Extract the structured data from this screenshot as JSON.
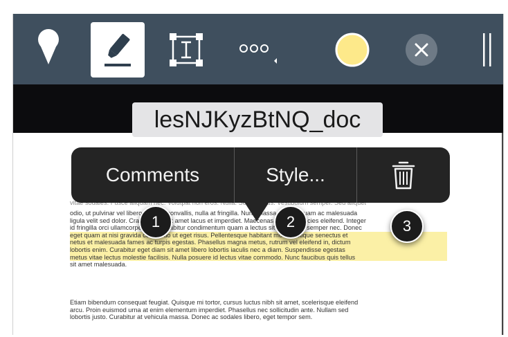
{
  "toolbar": {
    "tools": [
      {
        "icon": "pin-icon"
      },
      {
        "icon": "highlighter-icon",
        "selected": true
      },
      {
        "icon": "text-box-icon"
      },
      {
        "icon": "more-icon"
      },
      {
        "icon": "color-swatch-icon",
        "color": "#fde98a"
      },
      {
        "icon": "close-icon"
      },
      {
        "icon": "panel-toggle-icon"
      }
    ]
  },
  "document": {
    "title": "lesNJKyzBtNQ_doc",
    "paragraph1_top": "vitae sodales. Fusce aliquam nec. Volutpat non eros. Nulla. Sed et tellus. Vestibulum semper. Sed aliquet",
    "paragraph1_lines": [
      "odio, ut pulvinar vel libero porttitor convallis, nulla at fringilla. Nunc massa ultrices quam ac malesuada",
      "ligula velit sed dolor. Cras gravida sit amet lacus et imperdiet. Maecenas ultrices ultricies eleifend. Integer",
      "id fringilla orci ullamcorper nec. Curabitur condimentum quam a lectus sit amet eros semper nec. Donec",
      "eget quam at nisi gravida commodo ut eget risus. Pellentesque habitant morbi tristique senectus et",
      "netus et malesuada fames ac turpis egestas. Phasellus magna metus, rutrum vel eleifend in, dictum",
      "lobortis enim. Curabitur eget diam sit amet libero lobortis iaculis nec a diam. Suspendisse egestas",
      "metus vitae lectus molestie facilisis. Nulla posuere id lectus vitae commodo. Nunc faucibus quis tellus",
      "sit amet malesuada."
    ],
    "paragraph2_lines": [
      "Etiam bibendum consequat feugiat. Quisque mi tortor, cursus luctus nibh sit amet, scelerisque eleifend",
      "arcu. Proin euismod urna at enim elementum imperdiet. Phasellus nec sollicitudin ante. Nullam sed",
      "lobortis justo. Curabitur at vehicula massa. Donec ac sodales libero, eget tempor sem."
    ]
  },
  "context_menu": {
    "comments_label": "Comments",
    "style_label": "Style...",
    "delete_icon": "trash-icon"
  },
  "callouts": [
    "1",
    "2",
    "3"
  ]
}
